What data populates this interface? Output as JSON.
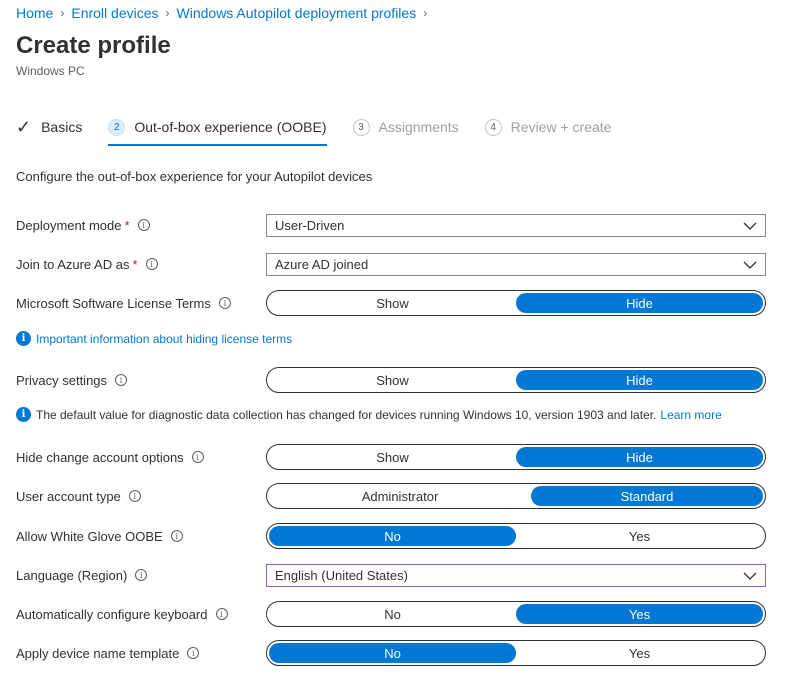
{
  "breadcrumb": [
    "Home",
    "Enroll devices",
    "Windows Autopilot deployment profiles"
  ],
  "page": {
    "title": "Create profile",
    "subtitle": "Windows PC"
  },
  "steps": [
    {
      "num": "",
      "label": "Basics"
    },
    {
      "num": "2",
      "label": "Out-of-box experience (OOBE)"
    },
    {
      "num": "3",
      "label": "Assignments"
    },
    {
      "num": "4",
      "label": "Review + create"
    }
  ],
  "description": "Configure the out-of-box experience for your Autopilot devices",
  "fields": {
    "deployment_mode": {
      "label": "Deployment mode",
      "required": "*",
      "value": "User-Driven"
    },
    "join_azure": {
      "label": "Join to Azure AD as",
      "required": "*",
      "value": "Azure AD joined"
    },
    "license_terms": {
      "label": "Microsoft Software License Terms",
      "options": [
        "Show",
        "Hide"
      ],
      "selected": "Hide"
    },
    "privacy": {
      "label": "Privacy settings",
      "options": [
        "Show",
        "Hide"
      ],
      "selected": "Hide"
    },
    "hide_change_account": {
      "label": "Hide change account options",
      "options": [
        "Show",
        "Hide"
      ],
      "selected": "Hide"
    },
    "user_account_type": {
      "label": "User account type",
      "options": [
        "Administrator",
        "Standard"
      ],
      "selected": "Standard"
    },
    "white_glove": {
      "label": "Allow White Glove OOBE",
      "options": [
        "No",
        "Yes"
      ],
      "selected": "No"
    },
    "language": {
      "label": "Language (Region)",
      "value": "English (United States)"
    },
    "auto_keyboard": {
      "label": "Automatically configure keyboard",
      "options": [
        "No",
        "Yes"
      ],
      "selected": "Yes"
    },
    "device_name_template": {
      "label": "Apply device name template",
      "options": [
        "No",
        "Yes"
      ],
      "selected": "No"
    }
  },
  "notices": {
    "license_link": "Important information about hiding license terms",
    "privacy_text": "The default value for diagnostic data collection has changed for devices running Windows 10, version 1903 and later.",
    "privacy_link": "Learn more"
  },
  "colors": {
    "accent": "#0078d4",
    "required": "#a4262c"
  }
}
